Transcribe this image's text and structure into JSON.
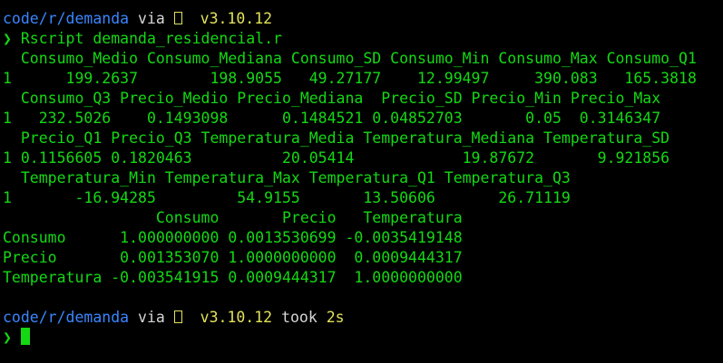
{
  "prompt1": {
    "path": "code/r/demanda",
    "via": "via",
    "icon": "r-language-icon",
    "version": "v3.10.12"
  },
  "command": {
    "symbol": "❯",
    "text": "Rscript demanda_residencial.r"
  },
  "output": [
    "  Consumo_Medio Consumo_Mediana Consumo_SD Consumo_Min Consumo_Max Consumo_Q1",
    "1      199.2637        198.9055   49.27177    12.99497     390.083   165.3818",
    "  Consumo_Q3 Precio_Medio Precio_Mediana  Precio_SD Precio_Min Precio_Max",
    "1   232.5026    0.1493098      0.1484521 0.04852703       0.05  0.3146347",
    "  Precio_Q1 Precio_Q3 Temperatura_Media Temperatura_Mediana Temperatura_SD",
    "1 0.1156605 0.1820463          20.05414            19.87672       9.921856",
    "  Temperatura_Min Temperatura_Max Temperatura_Q1 Temperatura_Q3",
    "1       -16.94285         54.9155       13.50606       26.71119",
    "                 Consumo       Precio   Temperatura",
    "Consumo      1.000000000 0.0013530699 -0.0035419148",
    "Precio       0.001353070 1.0000000000  0.0009444317",
    "Temperatura -0.003541915 0.0009444317  1.0000000000"
  ],
  "prompt2": {
    "path": "code/r/demanda",
    "via": "via",
    "icon": "r-language-icon",
    "version": "v3.10.12",
    "took": "took",
    "duration": "2s"
  },
  "prompt_symbol": "❯",
  "colors": {
    "background": "#000000",
    "text": "#14d814",
    "path": "#3a86ff",
    "version": "#e2e25a"
  }
}
